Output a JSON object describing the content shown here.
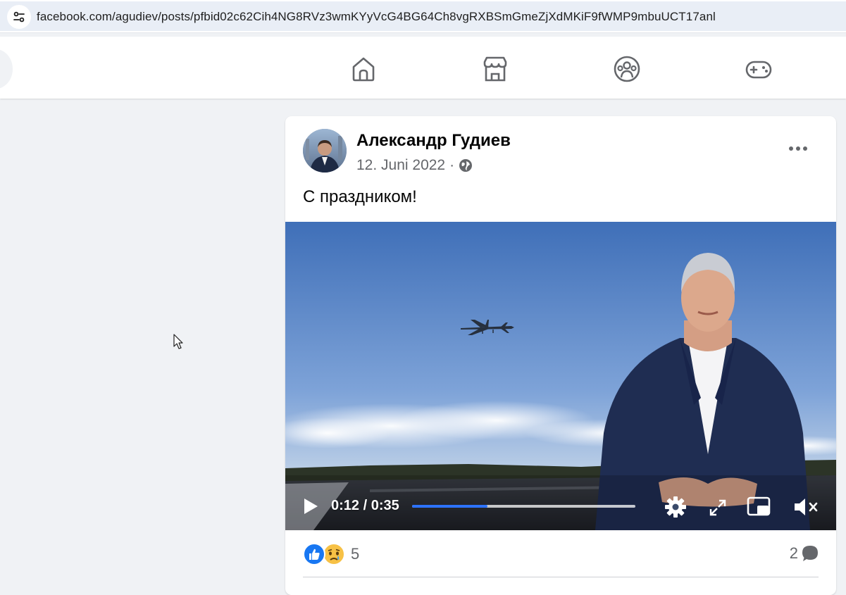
{
  "browser": {
    "url": "facebook.com/agudiev/posts/pfbid02c62Cih4NG8RVz3wmKYyVcG4BG64Ch8vgRXBSmGmeZjXdMKiF9fWMP9mbuUCT17anl",
    "site_info_icon": "tune-icon"
  },
  "nav": {
    "items": [
      {
        "name": "home",
        "icon": "home-icon"
      },
      {
        "name": "marketplace",
        "icon": "store-icon"
      },
      {
        "name": "groups",
        "icon": "groups-icon"
      },
      {
        "name": "gaming",
        "icon": "gamepad-icon"
      }
    ]
  },
  "post": {
    "author": "Александр Гудиев",
    "date": "12. Juni 2022",
    "separator": "·",
    "audience_icon": "globe-icon",
    "caption": "С праздником!",
    "video": {
      "current_time": "0:12",
      "duration": "0:35",
      "time_display": "0:12 / 0:35",
      "progress": 0.336,
      "muted": true
    },
    "reactions": {
      "types": [
        "like",
        "sad"
      ],
      "count": "5"
    },
    "comments_count": "2"
  },
  "colors": {
    "page_bg": "#f0f2f5",
    "card_bg": "#ffffff",
    "progress_fill": "#2d73ff",
    "like_blue": "#1877f2",
    "text_primary": "#050505",
    "text_secondary": "#65676b"
  }
}
